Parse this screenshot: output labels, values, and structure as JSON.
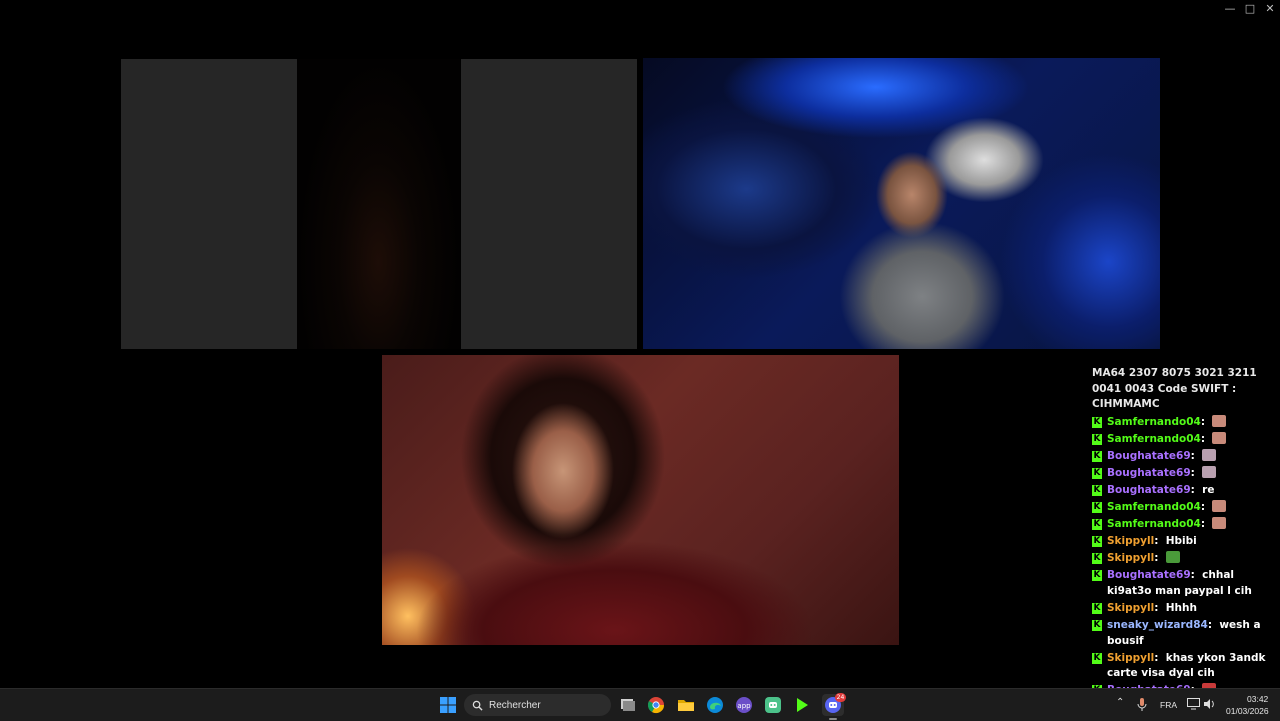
{
  "window": {
    "controls": [
      "minimize",
      "maximize",
      "close"
    ]
  },
  "chat": {
    "top_text": "MA64 2307 8075 3021 3211 0041 0043 Code SWIFT : CIHMMAMC",
    "messages": [
      {
        "user": "Samfernando04",
        "color": "#53fc18",
        "text": "",
        "emote": "cat-emote"
      },
      {
        "user": "Samfernando04",
        "color": "#53fc18",
        "text": "",
        "emote": "cat-emote"
      },
      {
        "user": "Boughatate69",
        "color": "#a970ff",
        "text": "",
        "emote": "figure-emote"
      },
      {
        "user": "Boughatate69",
        "color": "#a970ff",
        "text": "",
        "emote": "figure-emote"
      },
      {
        "user": "Boughatate69",
        "color": "#a970ff",
        "text": "re",
        "emote": ""
      },
      {
        "user": "Samfernando04",
        "color": "#53fc18",
        "text": "",
        "emote": "cat-emote"
      },
      {
        "user": "Samfernando04",
        "color": "#53fc18",
        "text": "",
        "emote": "cat-emote"
      },
      {
        "user": "Skippyll",
        "color": "#f0a030",
        "text": "Hbibi",
        "emote": ""
      },
      {
        "user": "Skippyll",
        "color": "#f0a030",
        "text": "",
        "emote": "frog-emote"
      },
      {
        "user": "Boughatate69",
        "color": "#a970ff",
        "text": "chhal ki9at3o man paypal l cih",
        "emote": ""
      },
      {
        "user": "Skippyll",
        "color": "#f0a030",
        "text": "Hhhh",
        "emote": ""
      },
      {
        "user": "sneaky_wizard84",
        "color": "#9ab7ff",
        "text": "wesh a bousif",
        "emote": ""
      },
      {
        "user": "Skippyll",
        "color": "#f0a030",
        "text": "khas ykon 3andk carte visa dyal cih",
        "emote": ""
      },
      {
        "user": "Boughatate69",
        "color": "#a970ff",
        "text": "",
        "emote": "devil-emote"
      }
    ]
  },
  "taskbar": {
    "search_placeholder": "Rechercher",
    "apps": [
      "start-icon",
      "task-view-icon",
      "chrome-icon",
      "file-explorer-icon",
      "edge-icon",
      "app-icon",
      "discord-icon",
      "kick-icon",
      "discord-icon"
    ],
    "discord_badge": "24",
    "language": "FRA",
    "time": "03:42",
    "date": "01/03/2026"
  }
}
